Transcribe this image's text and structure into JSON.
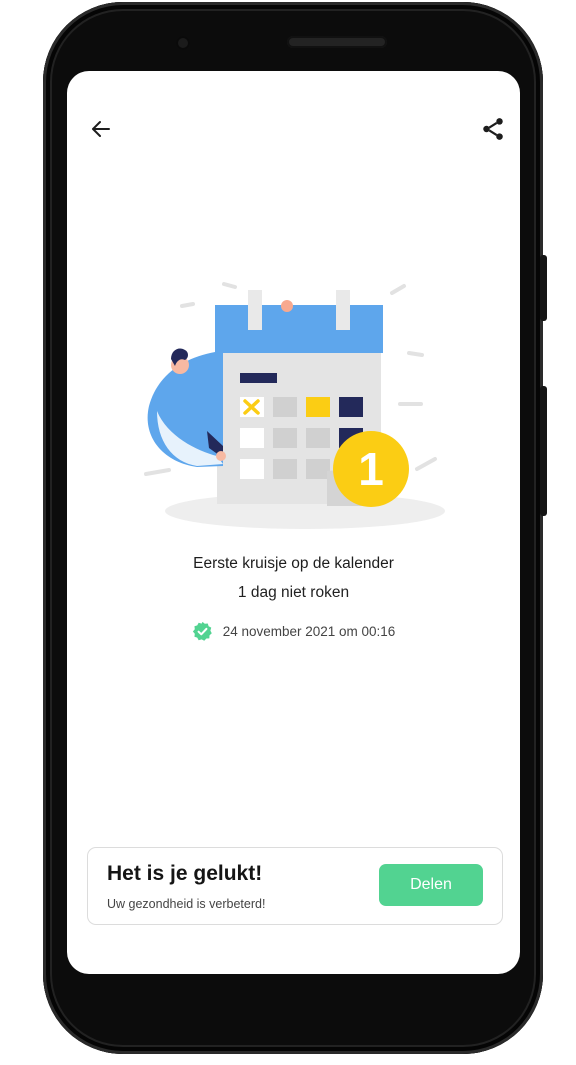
{
  "header": {
    "back_icon": "arrow-left-icon",
    "share_icon": "share-icon"
  },
  "milestone": {
    "title": "Eerste kruisje op de kalender",
    "subtitle": "1 dag niet roken",
    "date": "24 november 2021 om 00:16",
    "badge_number": "1",
    "verified_icon": "verified-check-icon"
  },
  "card": {
    "title": "Het is je gelukt!",
    "subtitle": "Uw gezondheid is verbeterd!",
    "button_label": "Delen"
  },
  "colors": {
    "accent_green": "#52d391",
    "calendar_blue": "#5ea6ec",
    "badge_yellow": "#fbcd14",
    "navy": "#23295a"
  }
}
